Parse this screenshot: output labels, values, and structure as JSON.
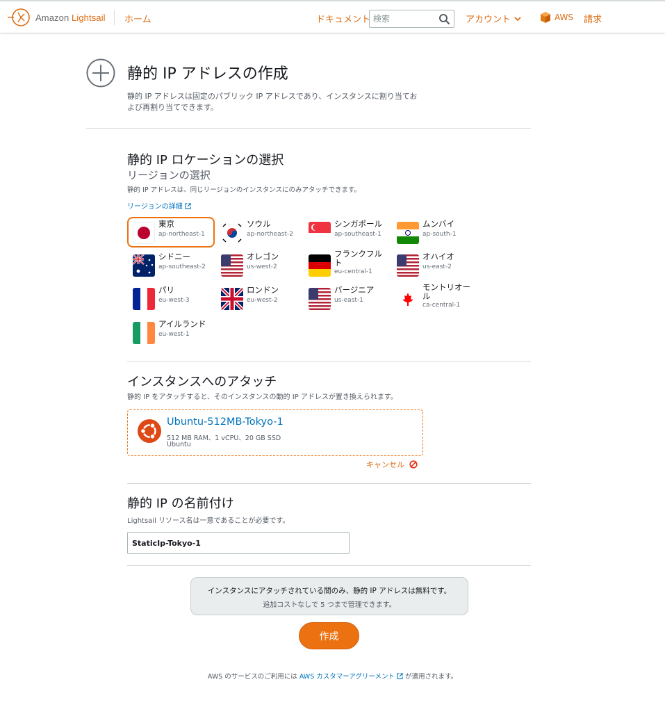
{
  "header": {
    "brand_prefix": "Amazon",
    "brand_name": "Lightsail",
    "home": "ホーム",
    "docs": "ドキュメント",
    "search_placeholder": "検索",
    "account": "アカウント",
    "aws": "AWS",
    "billing": "請求"
  },
  "page": {
    "title": "静的 IP アドレスの作成",
    "description": "静的 IP アドレスは固定のパブリック IP アドレスであり、インスタンスに割り当ておよび再割り当てできます。"
  },
  "location": {
    "title": "静的 IP ロケーションの選択",
    "subtitle": "リージョンの選択",
    "note": "静的 IP アドレスは、同じリージョンのインスタンスにのみアタッチできます。",
    "details_link": "リージョンの詳細",
    "regions": [
      {
        "name": "東京",
        "code": "ap-northeast-1",
        "flag": "japan-flag",
        "selected": true
      },
      {
        "name": "ソウル",
        "code": "ap-northeast-2",
        "flag": "korea-flag"
      },
      {
        "name": "シンガポール",
        "code": "ap-southeast-1",
        "flag": "singapore-flag"
      },
      {
        "name": "ムンバイ",
        "code": "ap-south-1",
        "flag": "india-flag"
      },
      {
        "name": "シドニー",
        "code": "ap-southeast-2",
        "flag": "australia-flag"
      },
      {
        "name": "オレゴン",
        "code": "us-west-2",
        "flag": "usa-flag"
      },
      {
        "name": "フランクフルト",
        "code": "eu-central-1",
        "flag": "germany-flag"
      },
      {
        "name": "オハイオ",
        "code": "us-east-2",
        "flag": "usa-flag"
      },
      {
        "name": "パリ",
        "code": "eu-west-3",
        "flag": "france-flag"
      },
      {
        "name": "ロンドン",
        "code": "eu-west-2",
        "flag": "uk-flag"
      },
      {
        "name": "バージニア",
        "code": "us-east-1",
        "flag": "usa-flag"
      },
      {
        "name": "モントリオール",
        "code": "ca-central-1",
        "flag": "canada-flag"
      },
      {
        "name": "アイルランド",
        "code": "eu-west-1",
        "flag": "ireland-flag"
      }
    ]
  },
  "attach": {
    "title": "インスタンスへのアタッチ",
    "note": "静的 IP をアタッチすると、そのインスタンスの動的 IP アドレスが置き換えられます。",
    "instance_name": "Ubuntu-512MB-Tokyo-1",
    "instance_spec": "512 MB RAM、1 vCPU、20 GB SSD",
    "instance_os": "Ubuntu",
    "cancel": "キャンセル"
  },
  "naming": {
    "title": "静的 IP の名前付け",
    "note": "Lightsail リソース名は一意であることが必要です。",
    "value": "StaticIp-Tokyo-1"
  },
  "info": {
    "line1": "インスタンスにアタッチされている間のみ、静的 IP アドレスは無料です。",
    "line2": "追加コストなしで 5 つまで管理できます。"
  },
  "create_button": "作成",
  "footer": {
    "prefix": "AWS のサービスのご利用には",
    "link": "AWS カスタマーアグリーメント",
    "suffix": "が適用されます。"
  },
  "colors": {
    "accent": "#ec7211",
    "link": "#0073bb"
  }
}
